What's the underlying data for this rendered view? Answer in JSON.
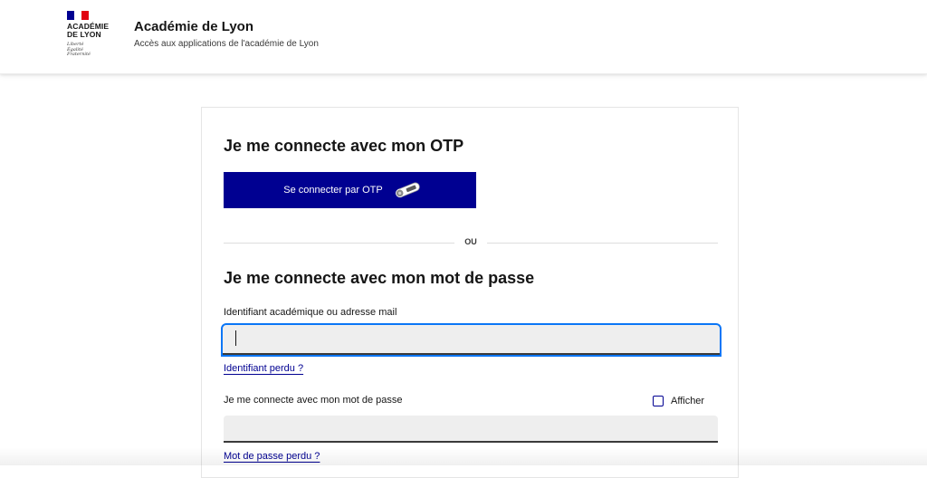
{
  "header": {
    "logo": {
      "flag_colors": [
        "#000091",
        "#ffffff",
        "#e1000f"
      ],
      "title_line1": "ACADÉMIE",
      "title_line2": "DE LYON",
      "motto_line1": "Liberté",
      "motto_line2": "Égalité",
      "motto_line3": "Fraternité"
    },
    "site_title": "Académie de Lyon",
    "site_subtitle": "Accès aux applications de l'académie de Lyon"
  },
  "otp_section": {
    "heading": "Je me connecte avec mon OTP",
    "button_label": "Se connecter par OTP",
    "button_icon": "otp-token-icon"
  },
  "separator": {
    "label": "OU"
  },
  "password_section": {
    "heading": "Je me connecte avec mon mot de passe",
    "identifier_label": "Identifiant académique ou adresse mail",
    "identifier_value": "",
    "identifier_lost_link": "Identifiant perdu ?",
    "password_label": "Je me connecte avec mon mot de passe",
    "password_value": "",
    "show_password_label": "Afficher",
    "show_password_checked": false,
    "password_lost_link": "Mot de passe perdu ?"
  },
  "colors": {
    "brand_blue": "#000091",
    "focus_ring": "#0a76f6",
    "input_bg": "#eeeeee"
  }
}
